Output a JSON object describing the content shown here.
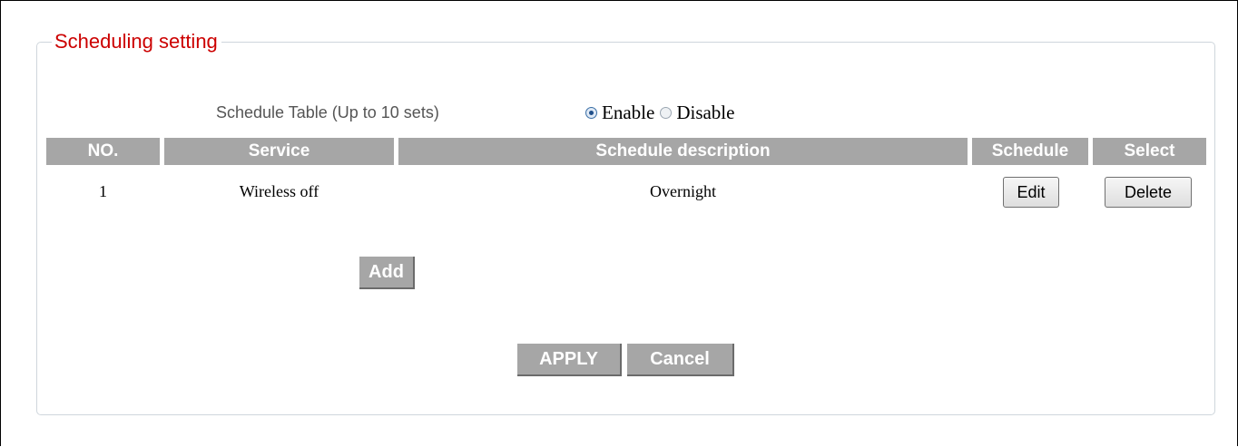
{
  "section": {
    "title": "Scheduling setting"
  },
  "schedule_table": {
    "label": "Schedule Table (Up to 10 sets)",
    "options": [
      {
        "label": "Enable",
        "selected": true
      },
      {
        "label": "Disable",
        "selected": false
      }
    ]
  },
  "table": {
    "headers": {
      "no": "NO.",
      "service": "Service",
      "description": "Schedule description",
      "schedule": "Schedule",
      "select": "Select"
    },
    "rows": [
      {
        "no": "1",
        "service": "Wireless off",
        "description": "Overnight",
        "schedule_button": "Edit",
        "select_button": "Delete"
      }
    ]
  },
  "buttons": {
    "add": "Add",
    "apply": "APPLY",
    "cancel": "Cancel"
  },
  "colors": {
    "title": "#cc0000",
    "header_bg": "#a6a6a6",
    "header_text": "#ffffff"
  }
}
